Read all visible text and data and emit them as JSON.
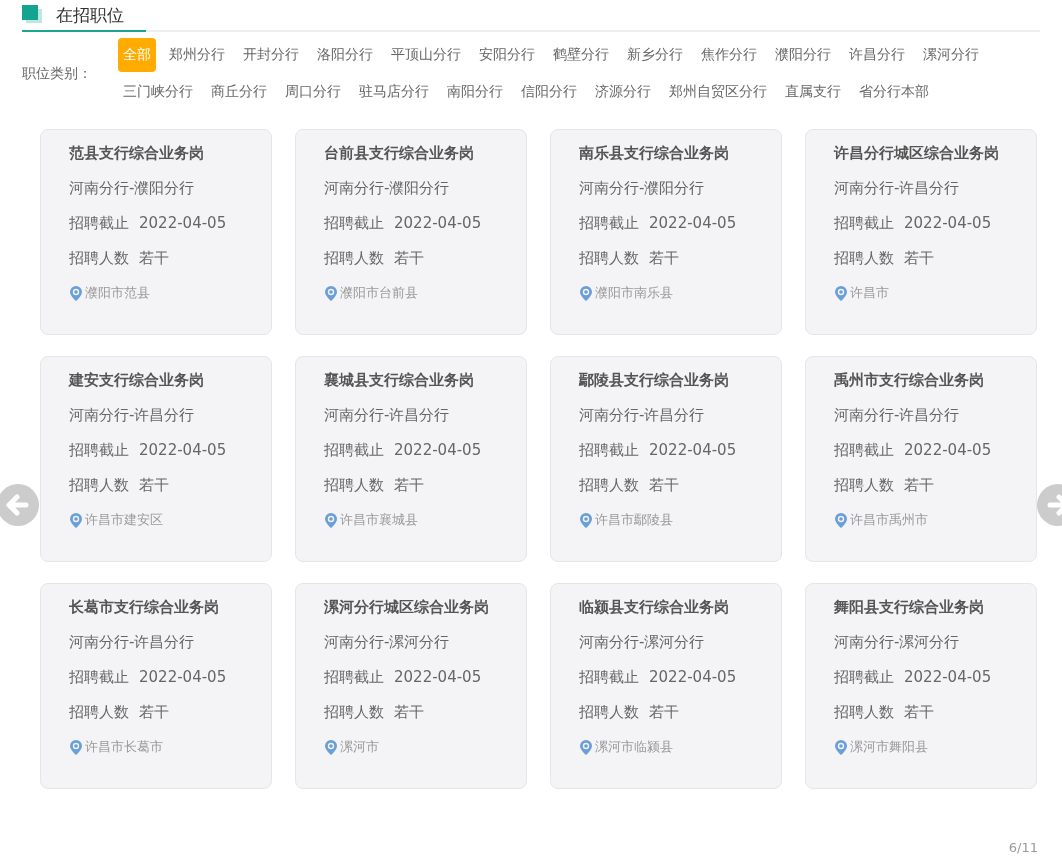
{
  "section_title": "在招职位",
  "filter": {
    "label": "职位类别：",
    "options": [
      {
        "label": "全部",
        "selected": true
      },
      {
        "label": "郑州分行",
        "selected": false
      },
      {
        "label": "开封分行",
        "selected": false
      },
      {
        "label": "洛阳分行",
        "selected": false
      },
      {
        "label": "平顶山分行",
        "selected": false
      },
      {
        "label": "安阳分行",
        "selected": false
      },
      {
        "label": "鹤壁分行",
        "selected": false
      },
      {
        "label": "新乡分行",
        "selected": false
      },
      {
        "label": "焦作分行",
        "selected": false
      },
      {
        "label": "濮阳分行",
        "selected": false
      },
      {
        "label": "许昌分行",
        "selected": false
      },
      {
        "label": "漯河分行",
        "selected": false
      },
      {
        "label": "三门峡分行",
        "selected": false
      },
      {
        "label": "商丘分行",
        "selected": false
      },
      {
        "label": "周口分行",
        "selected": false
      },
      {
        "label": "驻马店分行",
        "selected": false
      },
      {
        "label": "南阳分行",
        "selected": false
      },
      {
        "label": "信阳分行",
        "selected": false
      },
      {
        "label": "济源分行",
        "selected": false
      },
      {
        "label": "郑州自贸区分行",
        "selected": false
      },
      {
        "label": "直属支行",
        "selected": false
      },
      {
        "label": "省分行本部",
        "selected": false
      }
    ]
  },
  "jobs": [
    {
      "title": "范县支行综合业务岗",
      "branch": "河南分行-濮阳分行",
      "deadline_label": "招聘截止",
      "deadline": "2022-04-05",
      "count_label": "招聘人数",
      "count": "若干",
      "location": "濮阳市范县"
    },
    {
      "title": "台前县支行综合业务岗",
      "branch": "河南分行-濮阳分行",
      "deadline_label": "招聘截止",
      "deadline": "2022-04-05",
      "count_label": "招聘人数",
      "count": "若干",
      "location": "濮阳市台前县"
    },
    {
      "title": "南乐县支行综合业务岗",
      "branch": "河南分行-濮阳分行",
      "deadline_label": "招聘截止",
      "deadline": "2022-04-05",
      "count_label": "招聘人数",
      "count": "若干",
      "location": "濮阳市南乐县"
    },
    {
      "title": "许昌分行城区综合业务岗",
      "branch": "河南分行-许昌分行",
      "deadline_label": "招聘截止",
      "deadline": "2022-04-05",
      "count_label": "招聘人数",
      "count": "若干",
      "location": "许昌市"
    },
    {
      "title": "建安支行综合业务岗",
      "branch": "河南分行-许昌分行",
      "deadline_label": "招聘截止",
      "deadline": "2022-04-05",
      "count_label": "招聘人数",
      "count": "若干",
      "location": "许昌市建安区"
    },
    {
      "title": "襄城县支行综合业务岗",
      "branch": "河南分行-许昌分行",
      "deadline_label": "招聘截止",
      "deadline": "2022-04-05",
      "count_label": "招聘人数",
      "count": "若干",
      "location": "许昌市襄城县"
    },
    {
      "title": "鄢陵县支行综合业务岗",
      "branch": "河南分行-许昌分行",
      "deadline_label": "招聘截止",
      "deadline": "2022-04-05",
      "count_label": "招聘人数",
      "count": "若干",
      "location": "许昌市鄢陵县"
    },
    {
      "title": "禹州市支行综合业务岗",
      "branch": "河南分行-许昌分行",
      "deadline_label": "招聘截止",
      "deadline": "2022-04-05",
      "count_label": "招聘人数",
      "count": "若干",
      "location": "许昌市禹州市"
    },
    {
      "title": "长葛市支行综合业务岗",
      "branch": "河南分行-许昌分行",
      "deadline_label": "招聘截止",
      "deadline": "2022-04-05",
      "count_label": "招聘人数",
      "count": "若干",
      "location": "许昌市长葛市"
    },
    {
      "title": "漯河分行城区综合业务岗",
      "branch": "河南分行-漯河分行",
      "deadline_label": "招聘截止",
      "deadline": "2022-04-05",
      "count_label": "招聘人数",
      "count": "若干",
      "location": "漯河市"
    },
    {
      "title": "临颍县支行综合业务岗",
      "branch": "河南分行-漯河分行",
      "deadline_label": "招聘截止",
      "deadline": "2022-04-05",
      "count_label": "招聘人数",
      "count": "若干",
      "location": "漯河市临颍县"
    },
    {
      "title": "舞阳县支行综合业务岗",
      "branch": "河南分行-漯河分行",
      "deadline_label": "招聘截止",
      "deadline": "2022-04-05",
      "count_label": "招聘人数",
      "count": "若干",
      "location": "漯河市舞阳县"
    }
  ],
  "pagination": "6/11"
}
